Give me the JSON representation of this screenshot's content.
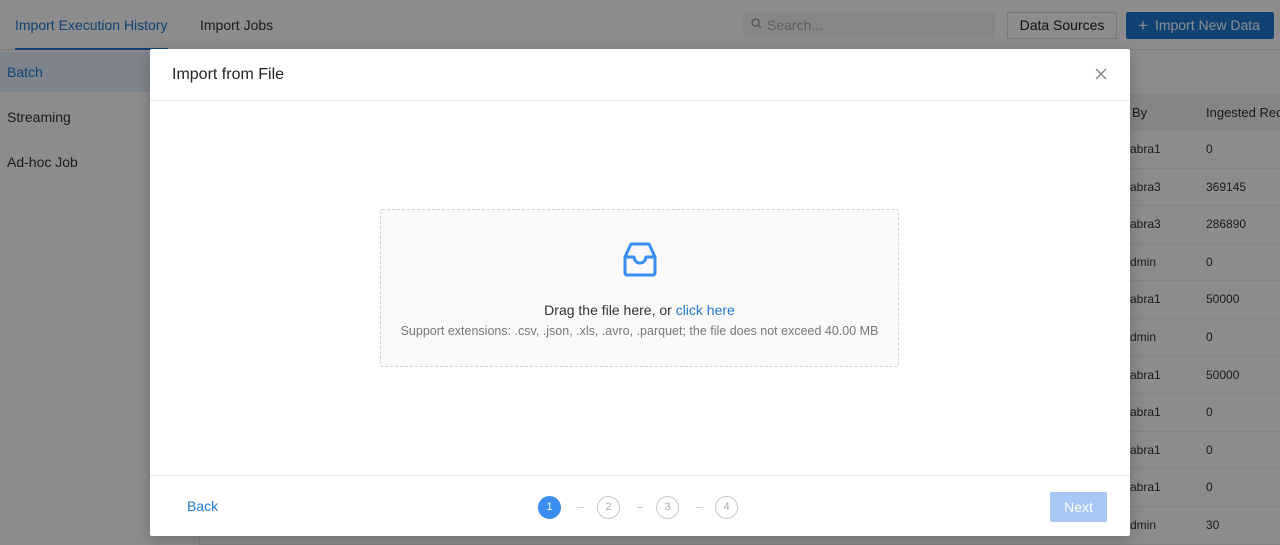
{
  "topbar": {
    "tabs": [
      {
        "label": "Import Execution History",
        "active": true
      },
      {
        "label": "Import Jobs",
        "active": false
      }
    ],
    "search_placeholder": "Search...",
    "data_sources_label": "Data Sources",
    "import_new_label": "Import New Data"
  },
  "sidebar": {
    "items": [
      {
        "label": "Batch",
        "active": true
      },
      {
        "label": "Streaming",
        "active": false
      },
      {
        "label": "Ad-hoc Job",
        "active": false
      }
    ]
  },
  "table": {
    "columns": [
      "By",
      "Ingested Rec"
    ],
    "rows": [
      [
        "abra1",
        "0"
      ],
      [
        "abra3",
        "369145"
      ],
      [
        "abra3",
        "286890"
      ],
      [
        "dmin",
        "0"
      ],
      [
        "abra1",
        "50000"
      ],
      [
        "dmin",
        "0"
      ],
      [
        "abra1",
        "50000"
      ],
      [
        "abra1",
        "0"
      ],
      [
        "abra1",
        "0"
      ],
      [
        "abra1",
        "0"
      ],
      [
        "dmin",
        "30"
      ]
    ]
  },
  "modal": {
    "title": "Import from File",
    "drop_text": "Drag the file here, or",
    "drop_link": "click here",
    "drop_hint": "Support extensions: .csv, .json, .xls, .avro, .parquet; the file does not exceed 40.00 MB",
    "back_label": "Back",
    "next_label": "Next",
    "steps": [
      "1",
      "2",
      "3",
      "4"
    ],
    "current_step": 1
  },
  "colors": {
    "accent": "#1f78d1",
    "step_active": "#3b8ef0",
    "next_disabled": "#a7c8f4",
    "overlay": "rgba(0,0,0,0.45)"
  }
}
